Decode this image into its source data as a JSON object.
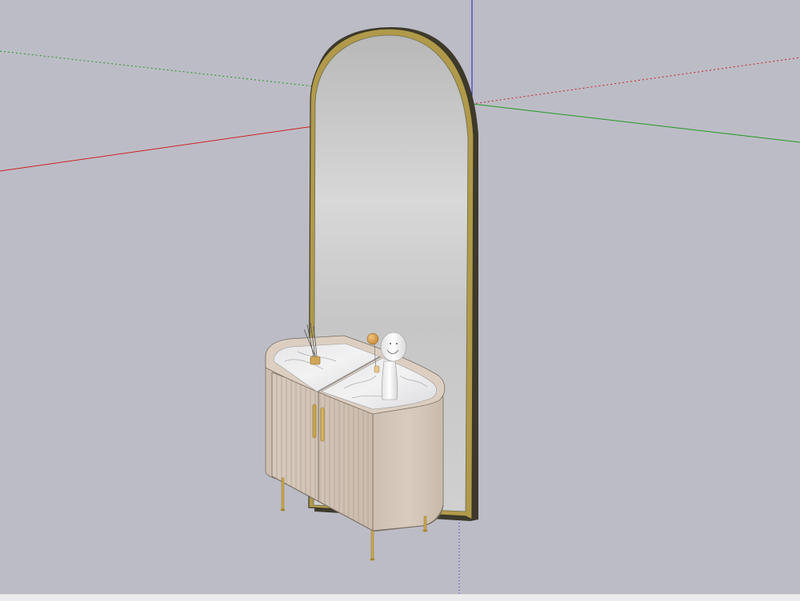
{
  "scene": {
    "axes": {
      "red": "#cc2222",
      "green": "#229922",
      "blue": "#2222cc"
    },
    "colors": {
      "background": "#bcbcc6",
      "mirror_frame": "#b09a4a",
      "mirror_glass": "#c9c9c9",
      "cabinet_body": "#d6c8bb",
      "cabinet_side": "#cdbfb1",
      "marble_top": "#e8e8ea",
      "brass": "#c9a64a",
      "figurine": "#f4f4f4",
      "balloon": "#d9a155"
    }
  }
}
